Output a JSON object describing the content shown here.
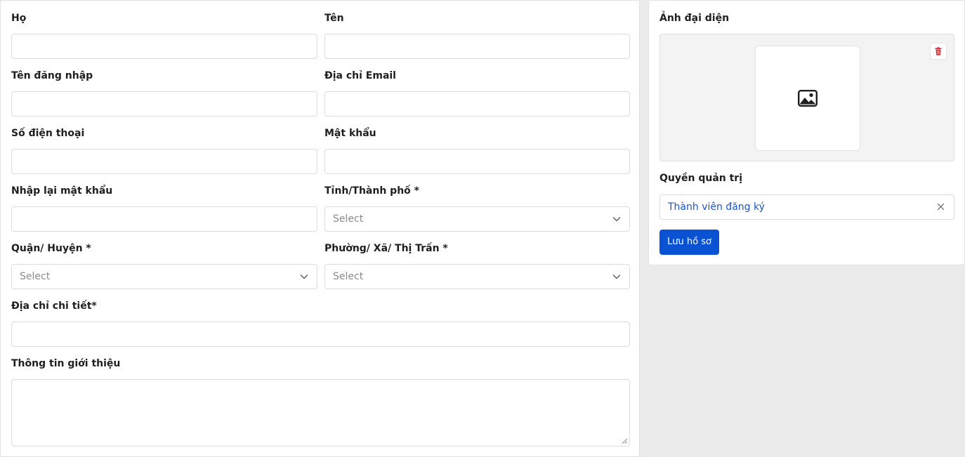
{
  "profile_form": {
    "last_name": {
      "label": "Họ",
      "value": ""
    },
    "first_name": {
      "label": "Tên",
      "value": ""
    },
    "username": {
      "label": "Tên đăng nhập",
      "value": ""
    },
    "email": {
      "label": "Địa chỉ Email",
      "value": ""
    },
    "phone": {
      "label": "Số điện thoại",
      "value": ""
    },
    "password": {
      "label": "Mật khẩu",
      "value": ""
    },
    "confirm_password": {
      "label": "Nhập lại mật khẩu",
      "value": ""
    },
    "province": {
      "label": "Tỉnh/Thành phố *",
      "placeholder": "Select"
    },
    "district": {
      "label": "Quận/ Huyện *",
      "placeholder": "Select"
    },
    "ward": {
      "label": "Phường/ Xã/ Thị Trấn *",
      "placeholder": "Select"
    },
    "address": {
      "label": "Địa chỉ chi tiết*",
      "value": ""
    },
    "bio": {
      "label": "Thông tin giới thiệu",
      "value": ""
    }
  },
  "sidebar": {
    "avatar": {
      "label": "Ảnh đại diện",
      "icon": "image-icon",
      "delete_icon": "trash-icon"
    },
    "role": {
      "label": "Quyền quản trị",
      "value": "Thành viên đăng ký"
    },
    "save_label": "Lưu hồ sơ"
  },
  "colors": {
    "primary": "#0a52d4",
    "role_text": "#1d55c4",
    "danger": "#e0242b",
    "page_bg": "#ebebeb"
  }
}
